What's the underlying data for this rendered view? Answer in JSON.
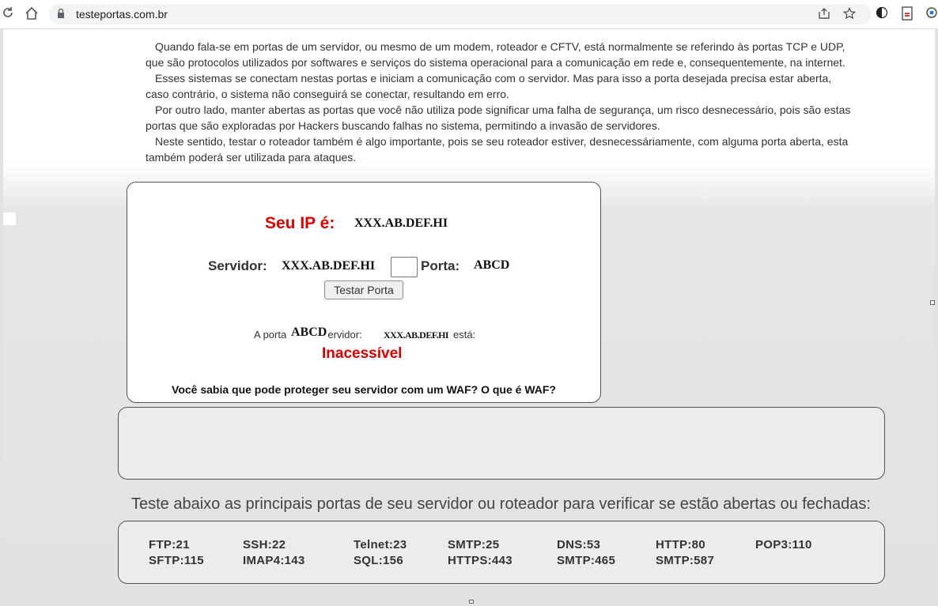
{
  "browser": {
    "url": "testeportas.com.br",
    "icons": [
      "refresh-icon",
      "home-icon",
      "lock-icon",
      "share-icon",
      "star-icon",
      "theme-icon",
      "pdf-extension-icon",
      "chrome-extension-icon"
    ]
  },
  "intro": {
    "paragraphs": [
      "Quando fala-se em portas de um servidor, ou mesmo de um modem, roteador e CFTV, está normalmente se referindo às portas TCP e UDP, que são protocolos utilizados por softwares e serviços do sistema operacional para a comunicação em rede e, consequentemente, na internet.",
      "Esses sistemas se conectam nestas portas e iniciam a comunicação com o servidor. Mas para isso a porta desejada precisa estar aberta, caso contrário, o sistema não conseguirá se conectar, resultando em erro.",
      "Por outro lado, manter abertas as portas que você não utiliza pode significar uma falha de segurança, um risco desnecessário, pois são estas portas que são exploradas por Hackers buscando falhas no sistema, permitindo a invasão de servidores.",
      "Neste sentido, testar o roteador também é algo importante, pois se seu roteador estiver, desnecessáriamente, com alguma porta aberta, esta também poderá ser utilizada para ataques."
    ]
  },
  "tester": {
    "ip_label": "Seu IP é:",
    "ip_value": "XXX.AB.DEF.HI",
    "server_label": "Servidor:",
    "server_value": "XXX.AB.DEF.HI",
    "port_label": "Porta:",
    "port_value": "ABCD",
    "button": "Testar Porta",
    "result_prefix": "A porta",
    "result_middle": "o servidor:",
    "result_suffix": "está:",
    "result_port": "ABCD",
    "result_server": "XXX.AB.DEF.HI",
    "status": "Inacessível",
    "waf_question": "Você sabia que pode proteger seu servidor com um WAF?",
    "waf_link": "O que é WAF?",
    "colors": {
      "label_red": "#e00000",
      "status_red": "#d90000"
    }
  },
  "ports_section": {
    "heading": "Teste abaixo as principais portas de seu servidor ou roteador para verificar se estão abertas ou fechadas:",
    "row1": [
      "FTP:21",
      "SSH:22",
      "Telnet:23",
      "SMTP:25",
      "DNS:53",
      "HTTP:80",
      "POP3:110"
    ],
    "row2": [
      "SFTP:115",
      "IMAP4:143",
      "SQL:156",
      "HTTPS:443",
      "SMTP:465",
      "SMTP:587"
    ]
  }
}
